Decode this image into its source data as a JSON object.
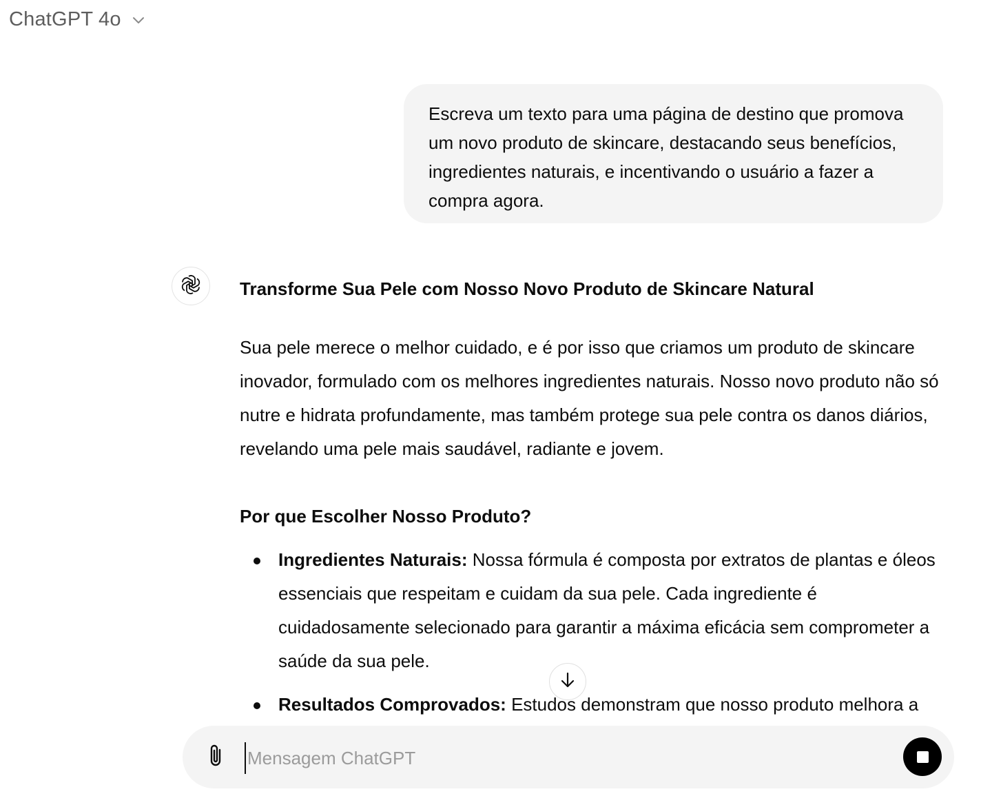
{
  "header": {
    "model_name": "ChatGPT 4o",
    "chevron_icon": "chevron-down-icon"
  },
  "conversation": {
    "user_message": "Escreva um texto para uma página de destino que promova um novo produto de skincare, destacando seus benefícios, ingredientes naturais, e incentivando o usuário a fazer a compra agora.",
    "assistant": {
      "avatar_icon": "openai-logo-icon",
      "title": "Transforme Sua Pele com Nosso Novo Produto de Skincare Natural",
      "intro": "Sua pele merece o melhor cuidado, e é por isso que criamos um produto de skincare inovador, formulado com os melhores ingredientes naturais. Nosso novo produto não só nutre e hidrata profundamente, mas também protege sua pele contra os danos diários, revelando uma pele mais saudável, radiante e jovem.",
      "subtitle": "Por que Escolher Nosso Produto?",
      "bullets": [
        {
          "label": "Ingredientes Naturais:",
          "text": "Nossa fórmula é composta por extratos de plantas e óleos essenciais que respeitam e cuidam da sua pele. Cada ingrediente é cuidadosamente selecionado para garantir a máxima eficácia sem comprometer a saúde da sua pele."
        },
        {
          "label": "Resultados Comprovados:",
          "text": "Estudos demonstram que nosso produto melhora a textura da pele, reduz a aparência de linhas finas e proporciona uma"
        }
      ]
    }
  },
  "scroll_button": {
    "icon": "arrow-down-icon"
  },
  "composer": {
    "placeholder": "Mensagem ChatGPT",
    "value": "",
    "attach_icon": "paperclip-icon",
    "stop_icon": "stop-icon"
  }
}
